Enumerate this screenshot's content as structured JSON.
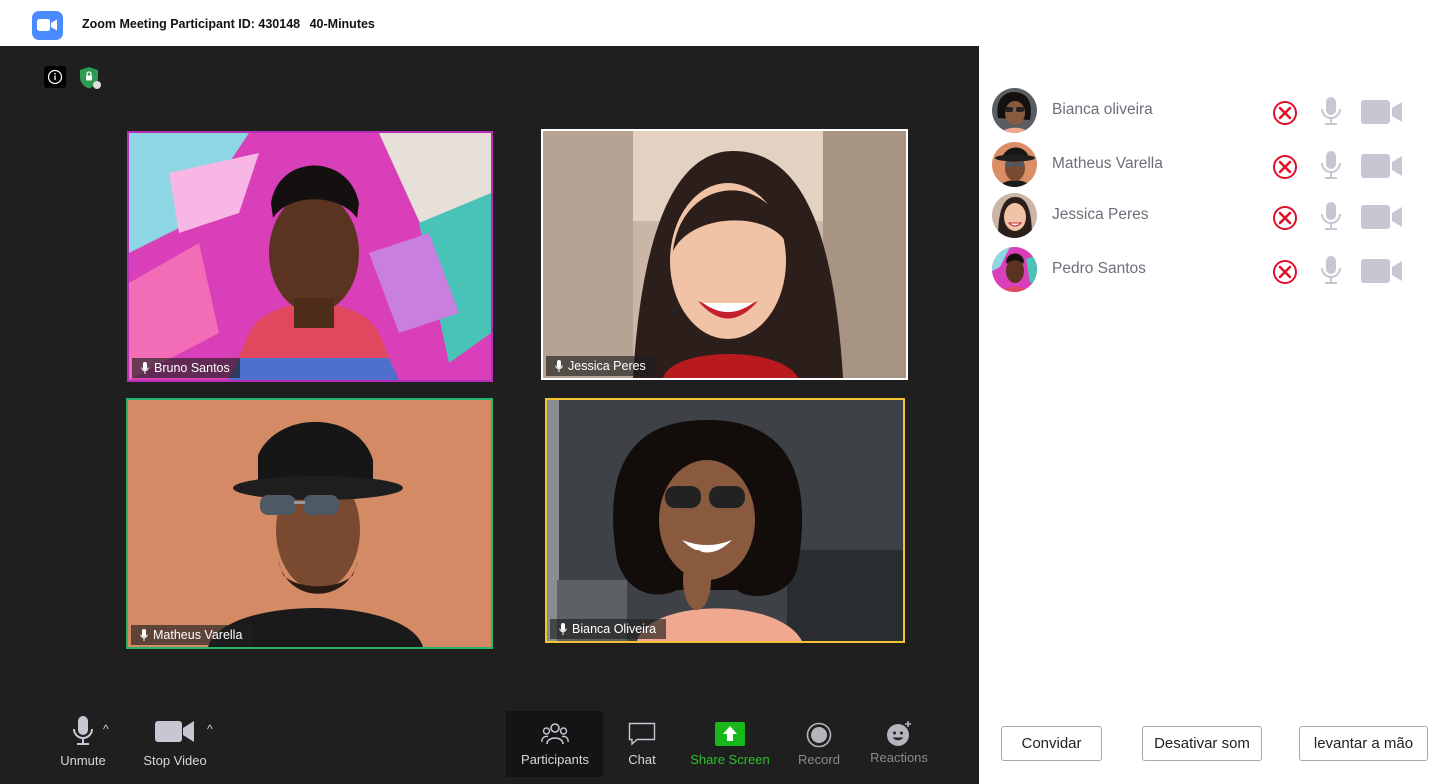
{
  "window": {
    "title_id": "Zoom Meeting Participant ID: 430148",
    "title_timer": "40-Minutes"
  },
  "tiles": [
    {
      "name": "Bruno Santos",
      "border_color": "#b62fb6"
    },
    {
      "name": "Jessica Peres",
      "border_color": "#ffffff"
    },
    {
      "name": "Matheus Varella",
      "border_color": "#26b36b"
    },
    {
      "name": "Bianca Oliveira",
      "border_color": "#f2c230"
    }
  ],
  "toolbar": {
    "unmute": "Unmute",
    "stop_video": "Stop Video",
    "participants": "Participants",
    "chat": "Chat",
    "share_screen": "Share Screen",
    "record": "Record",
    "reactions": "Reactions",
    "caret": "^"
  },
  "sidebar": {
    "participants": [
      {
        "name": "Bianca oliveira"
      },
      {
        "name": "Matheus Varella"
      },
      {
        "name": "Jessica Peres"
      },
      {
        "name": "Pedro Santos"
      }
    ],
    "buttons": {
      "invite": "Convidar",
      "mute_all": "Desativar som",
      "raise_hand": "levantar a mão"
    }
  },
  "colors": {
    "meeting_bg": "#1f1f1f",
    "share_green": "#2bc22b",
    "remove_red": "#e0102a",
    "icon_gray": "#c7c7d4",
    "app_blue": "#4a8cff"
  }
}
